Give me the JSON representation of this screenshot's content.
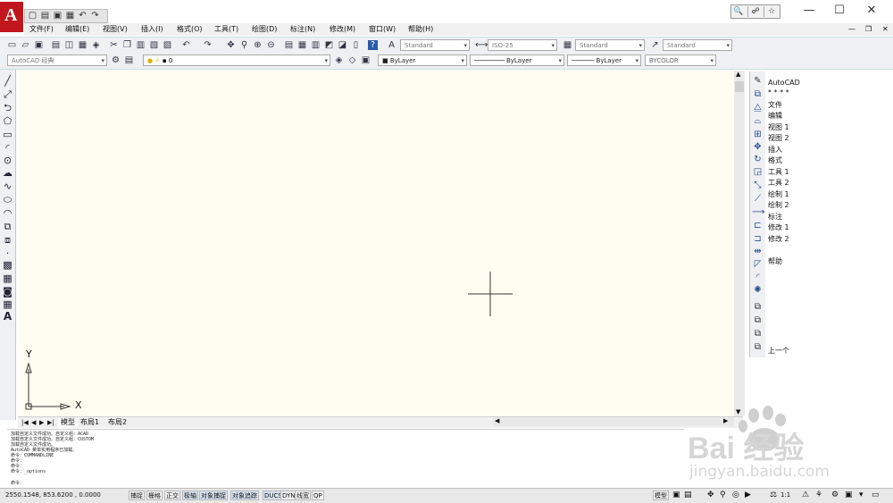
{
  "quick_access": [
    "▢",
    "▤",
    "▣",
    "▦",
    "↶",
    "↷"
  ],
  "search_tools": [
    "🔍",
    "☍",
    "☆"
  ],
  "window_controls": {
    "minimize": "—",
    "maximize": "☐",
    "close": "✕"
  },
  "menu": [
    "文件(F)",
    "编辑(E)",
    "视图(V)",
    "插入(I)",
    "格式(O)",
    "工具(T)",
    "绘图(D)",
    "标注(N)",
    "修改(M)",
    "窗口(W)",
    "帮助(H)"
  ],
  "doc_controls": [
    "—",
    "❐",
    "✕"
  ],
  "toolbar1": {
    "text_style": "Standard",
    "dim_style": "ISO-25",
    "table_style": "Standard",
    "multileader_style": "Standard"
  },
  "toolbar2": {
    "workspace": "AutoCAD 经典",
    "layer": "0",
    "color": "ByLayer",
    "linetype": "ByLayer",
    "lineweight": "ByLayer",
    "plot_style": "BYCOLOR"
  },
  "ucs": {
    "x_label": "X",
    "y_label": "Y"
  },
  "layout_tabs": [
    "模型",
    "布局1",
    "布局2"
  ],
  "right_list": [
    {
      "label": "AutoCAD"
    },
    {
      "label": "* * * *"
    },
    {
      "label": "文件"
    },
    {
      "label": "编辑"
    },
    {
      "label": "视图 1"
    },
    {
      "label": "视图 2"
    },
    {
      "label": "插入"
    },
    {
      "label": "格式"
    },
    {
      "label": "工具 1"
    },
    {
      "label": "工具 2"
    },
    {
      "label": "绘制 1"
    },
    {
      "label": "绘制 2"
    },
    {
      "label": "标注"
    },
    {
      "label": "修改 1"
    },
    {
      "label": "修改 2"
    },
    {
      "label": "帮助"
    },
    {
      "label": "上一个"
    }
  ],
  "command_lines": [
    "加载自定义文件成功。自定义组：ACAD",
    "加载自定义文件成功。自定义组：CUSTOM",
    "加载自定义文件成功。",
    "AutoCAD 菜单实用程序已加载。",
    "命令：COMMANDLINE",
    "命令：",
    "命令：",
    "命令：_options"
  ],
  "command_prompt": "命令：",
  "watermark": {
    "brand": "Bai  经验",
    "url": "jingyan.baidu.com"
  },
  "status": {
    "coordinates": "2550.1548, 853.6200 , 0.0000",
    "toggles": [
      "捕捉",
      "栅格",
      "正交",
      "极轴",
      "对象捕捉",
      "对象追踪",
      "DUCS",
      "DYN",
      "线宽",
      "QP"
    ],
    "model": "模型",
    "scale": "1:1"
  },
  "colors": {
    "drawing_bg": "#fffdf1",
    "logo": "#c0161c"
  }
}
